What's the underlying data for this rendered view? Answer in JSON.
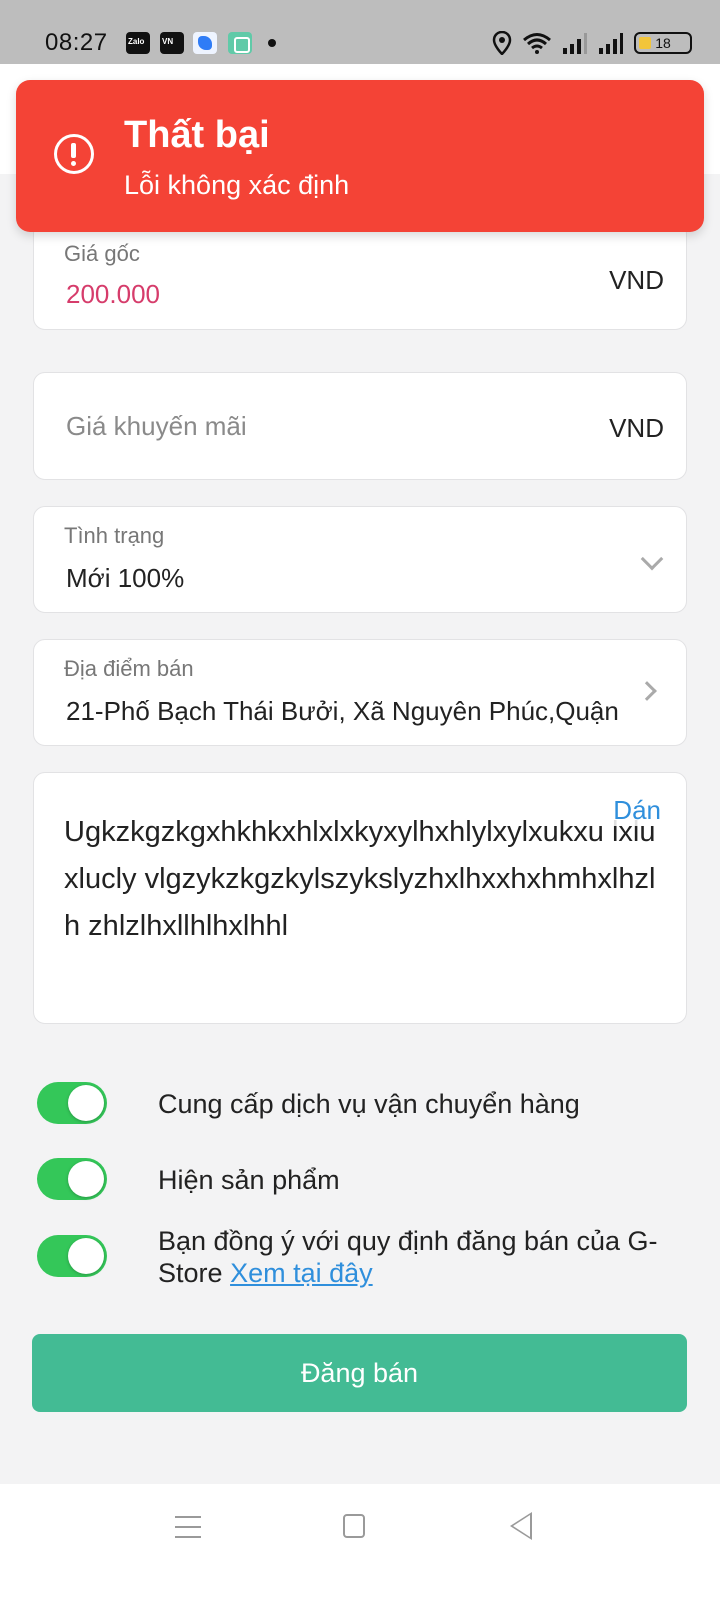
{
  "status_bar": {
    "time": "08:27",
    "apps": [
      "zalo-icon",
      "vn-app-icon",
      "blue-app-icon",
      "green-app-icon"
    ],
    "battery_level": "18"
  },
  "toast": {
    "title": "Thất bại",
    "message": "Lỗi không xác định",
    "color": "#f44336"
  },
  "form": {
    "original_price": {
      "label": "Giá gốc",
      "value": "200.000",
      "unit": "VND",
      "value_color": "#d63c6b"
    },
    "promo_price": {
      "placeholder": "Giá khuyến mãi",
      "unit": "VND"
    },
    "condition": {
      "label": "Tình trạng",
      "value": "Mới 100%"
    },
    "location": {
      "label": "Địa điểm bán",
      "value": "21-Phố Bạch Thái Bưởi, Xã Nguyên Phúc,Quận"
    },
    "description": {
      "text": "Ugkzkgzkgxhkhkxhlxlxkyxylhxhlylxylxukxu lxluxlucly vlgzykzkgzkylszykslyzhxlhxxhxhmhxlhzlh zhlzlhxllhlhxlhhl",
      "paste_label": "Dán"
    }
  },
  "toggles": {
    "shipping": {
      "label": "Cung cấp dịch vụ vận chuyển hàng",
      "on": true
    },
    "show_product": {
      "label": "Hiện sản phẩm",
      "on": true
    },
    "agree": {
      "label": "Bạn đồng ý với quy định đăng bán của G-Store",
      "link": "Xem tại đây",
      "on": true
    }
  },
  "submit": {
    "label": "Đăng bán",
    "color": "#43bb94"
  },
  "nav": {
    "icons": [
      "menu-icon",
      "home-icon",
      "back-icon"
    ]
  }
}
